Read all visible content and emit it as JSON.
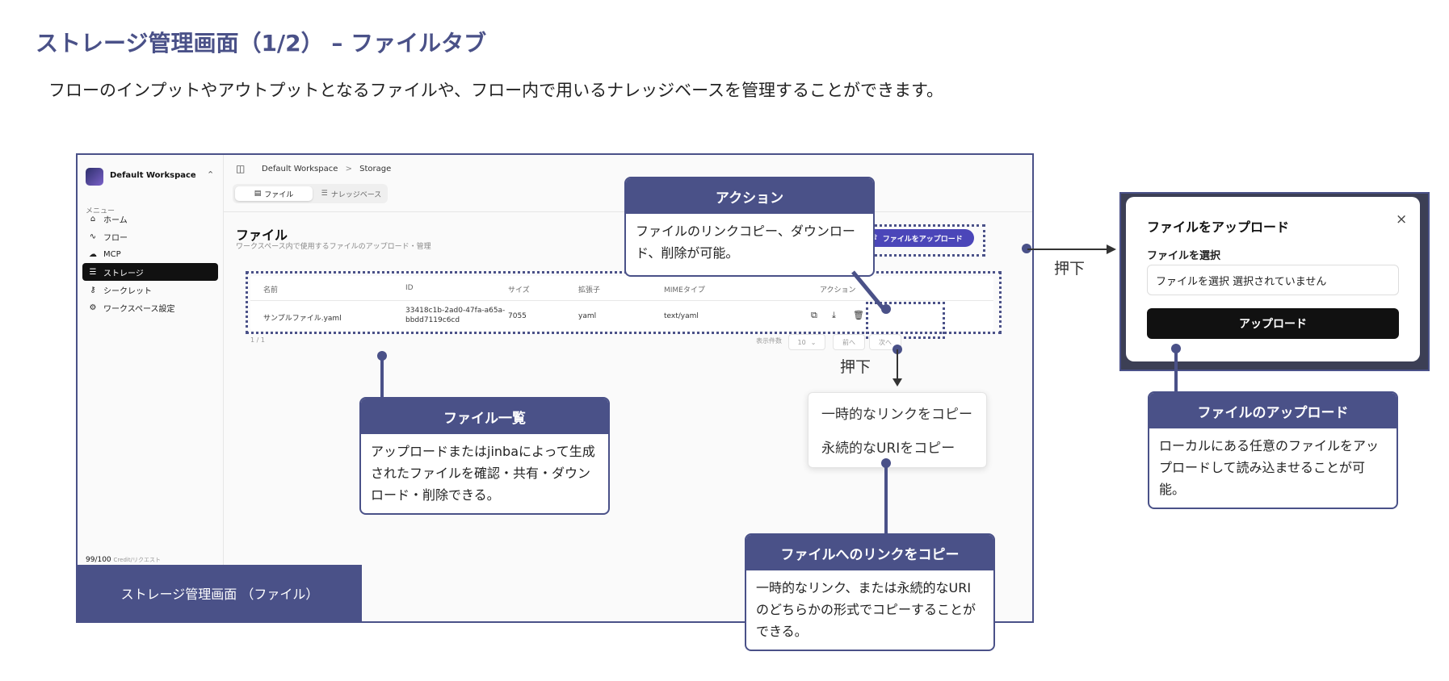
{
  "page": {
    "title": "ストレージ管理画面（1/2） – ファイルタブ",
    "description": "フローのインプットやアウトプットとなるファイルや、フロー内で用いるナレッジベースを管理することができます。"
  },
  "screenshot": {
    "caption": "ストレージ管理画面 （ファイル）",
    "sidebar": {
      "workspace_name": "Default Workspace",
      "menu_header": "メニュー",
      "items": [
        {
          "icon": "home-icon",
          "label": "ホーム",
          "active": false
        },
        {
          "icon": "flow-icon",
          "label": "フロー",
          "active": false
        },
        {
          "icon": "cloud-icon",
          "label": "MCP",
          "active": false
        },
        {
          "icon": "database-icon",
          "label": "ストレージ",
          "active": true
        },
        {
          "icon": "key-icon",
          "label": "シークレット",
          "active": false
        },
        {
          "icon": "gear-icon",
          "label": "ワークスペース設定",
          "active": false
        }
      ],
      "usage_count": "99/100",
      "usage_label": "Credit/リクエスト"
    },
    "breadcrumb": {
      "workspace": "Default Workspace",
      "separator": ">",
      "current": "Storage"
    },
    "tabs": {
      "files": "ファイル",
      "knowledge": "ナレッジベース"
    },
    "files_title": "ファイル",
    "files_subtitle": "ワークスペース内で使用するファイルのアップロード・管理",
    "upload_button": "ファイルをアップロード",
    "table": {
      "headers": [
        "名前",
        "ID",
        "サイズ",
        "拡張子",
        "MIMEタイプ",
        "アクション"
      ],
      "rows": [
        {
          "name": "サンプルファイル.yaml",
          "id_line1": "33418c1b-2ad0-47fa-a65a-",
          "id_line2": "bbdd7119c6cd",
          "size": "7055",
          "ext": "yaml",
          "mime": "text/yaml"
        }
      ]
    },
    "pagination": {
      "page_info": "1 / 1",
      "per_page_label": "表示件数",
      "per_page": "10",
      "prev": "前へ",
      "next": "次へ"
    },
    "link_menu": {
      "temporary": "一時的なリンクをコピー",
      "permanent": "永続的なURIをコピー"
    }
  },
  "callouts": {
    "action": {
      "title": "アクション",
      "body": "ファイルのリンクコピー、ダウンロード、削除が可能。"
    },
    "file_list": {
      "title": "ファイル一覧",
      "body": "アップロードまたはjinbaによって生成されたファイルを確認・共有・ダウンロード・削除できる。"
    },
    "copy_link": {
      "title": "ファイルへのリンクをコピー",
      "body": "一時的なリンク、または永続的なURIのどちらかの形式でコピーすることができる。"
    },
    "upload": {
      "title": "ファイルのアップロード",
      "body": "ローカルにある任意のファイルをアップロードして読み込ませることが可能。"
    }
  },
  "arrows": {
    "press_upload": "押下",
    "press_action": "押下"
  },
  "upload_dialog": {
    "title": "ファイルをアップロード",
    "close_icon": "×",
    "label": "ファイルを選択",
    "input_value": "ファイルを選択 選択されていません",
    "button": "アップロード"
  },
  "colors": {
    "accent": "#4a5188",
    "button": "#4b46b9"
  }
}
